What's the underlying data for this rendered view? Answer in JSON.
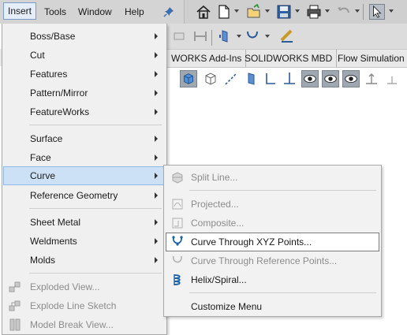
{
  "menubar": {
    "items": [
      {
        "label": "Insert"
      },
      {
        "label": "Tools"
      },
      {
        "label": "Window"
      },
      {
        "label": "Help"
      }
    ]
  },
  "tabs": [
    "WORKS Add-Ins",
    "SOLIDWORKS MBD",
    "Flow Simulation"
  ],
  "insert_menu": {
    "items": [
      {
        "label": "Boss/Base",
        "submenu": true,
        "disabled": false
      },
      {
        "label": "Cut",
        "submenu": true,
        "disabled": false
      },
      {
        "label": "Features",
        "submenu": true,
        "disabled": false
      },
      {
        "label": "Pattern/Mirror",
        "submenu": true,
        "disabled": false
      },
      {
        "label": "FeatureWorks",
        "submenu": true,
        "disabled": false
      },
      {
        "label": "Surface",
        "submenu": true,
        "disabled": false
      },
      {
        "label": "Face",
        "submenu": true,
        "disabled": false
      },
      {
        "label": "Curve",
        "submenu": true,
        "disabled": false,
        "highlighted": true
      },
      {
        "label": "Reference Geometry",
        "submenu": true,
        "disabled": false
      },
      {
        "label": "Sheet Metal",
        "submenu": true,
        "disabled": false
      },
      {
        "label": "Weldments",
        "submenu": true,
        "disabled": false
      },
      {
        "label": "Molds",
        "submenu": true,
        "disabled": false
      },
      {
        "label": "Exploded View...",
        "submenu": false,
        "disabled": true
      },
      {
        "label": "Explode Line Sketch",
        "submenu": false,
        "disabled": true
      },
      {
        "label": "Model Break View...",
        "submenu": false,
        "disabled": true
      }
    ]
  },
  "curve_submenu": {
    "items": [
      {
        "label": "Split Line...",
        "disabled": true
      },
      {
        "label": "Projected...",
        "disabled": true
      },
      {
        "label": "Composite...",
        "disabled": true
      },
      {
        "label": "Curve Through XYZ Points...",
        "disabled": false,
        "highlighted": true
      },
      {
        "label": "Curve Through Reference Points...",
        "disabled": true
      },
      {
        "label": "Helix/Spiral...",
        "disabled": false
      },
      {
        "label": "Customize Menu",
        "disabled": false
      }
    ]
  },
  "colors": {
    "menu_bg": "#f0f0f0",
    "highlight_bg": "#cce0f6",
    "highlight_border": "#90b8e4",
    "disabled_text": "#8c8c8c",
    "icon_blue": "#1a5fa8"
  }
}
